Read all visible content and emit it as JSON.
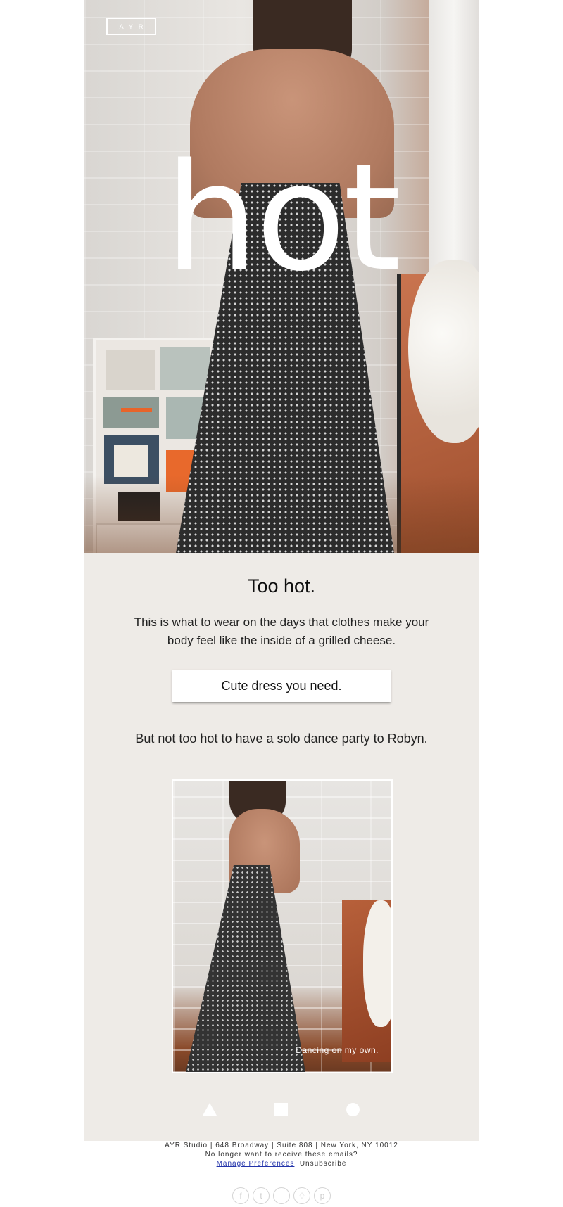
{
  "hero": {
    "logo_text": "AYR",
    "headline": "hot"
  },
  "content": {
    "title": "Too hot.",
    "body": "This is what to wear on the days that clothes make your body feel like the inside of a grilled cheese.",
    "cta_label": "Cute dress you need.",
    "subline": "But not too hot to have a solo dance party to Robyn.",
    "photo_caption": "Dancing on my own.",
    "shapes": [
      "triangle-icon",
      "square-icon",
      "circle-icon"
    ]
  },
  "footer": {
    "address": "AYR Studio | 648 Broadway | Suite 808 | New York, NY 10012",
    "unsubscribe_prompt": "No longer want to receive these emails?",
    "manage_link": "Manage Preferences",
    "separator": " |",
    "unsubscribe_link": "Unsubscribe"
  },
  "socials": [
    {
      "icon": "facebook-icon",
      "glyph": "f"
    },
    {
      "icon": "tumblr-icon",
      "glyph": "t"
    },
    {
      "icon": "instagram-icon",
      "glyph": "◻"
    },
    {
      "icon": "twitter-icon",
      "glyph": "♢"
    },
    {
      "icon": "pinterest-icon",
      "glyph": "p"
    }
  ],
  "colors": {
    "panel_bg": "#eeebe7",
    "cta_bg": "#ffffff",
    "link": "#2233aa"
  }
}
